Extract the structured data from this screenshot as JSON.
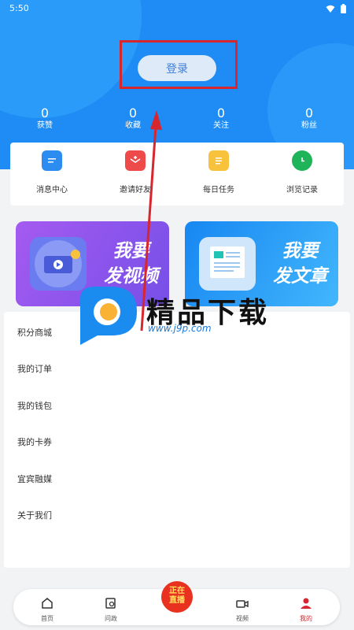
{
  "status_bar": {
    "time": "5:50"
  },
  "header": {
    "login_label": "登录"
  },
  "stats": [
    {
      "value": "0",
      "label": "获赞"
    },
    {
      "value": "0",
      "label": "收藏"
    },
    {
      "value": "0",
      "label": "关注"
    },
    {
      "value": "0",
      "label": "粉丝"
    }
  ],
  "quick_menu": [
    {
      "label": "消息中心",
      "icon": "message-icon",
      "color": "#2d8cf0"
    },
    {
      "label": "邀请好友",
      "icon": "envelope-icon",
      "color": "#ef4a4a"
    },
    {
      "label": "每日任务",
      "icon": "task-list-icon",
      "color": "#f9c23c"
    },
    {
      "label": "浏览记录",
      "icon": "clock-icon",
      "color": "#1fb35a"
    }
  ],
  "banners": [
    {
      "line1": "我要",
      "line2": "发视频"
    },
    {
      "line1": "我要",
      "line2": "发文章"
    }
  ],
  "list": [
    "积分商城",
    "我的订单",
    "我的钱包",
    "我的卡券",
    "宜宾融媒",
    "关于我们"
  ],
  "bottom_nav": [
    {
      "label": "首页",
      "icon": "home-icon"
    },
    {
      "label": "问政",
      "icon": "inquiry-icon"
    },
    {
      "label": "视频",
      "icon": "video-icon"
    },
    {
      "label": "我的",
      "icon": "profile-icon"
    }
  ],
  "live_badge": {
    "line1": "正在",
    "line2": "直播"
  },
  "watermark": {
    "title": "精品下载",
    "url": "www.j9p.com"
  },
  "colors": {
    "header_blue": "#1e8cf4",
    "active_red": "#d8262f"
  }
}
